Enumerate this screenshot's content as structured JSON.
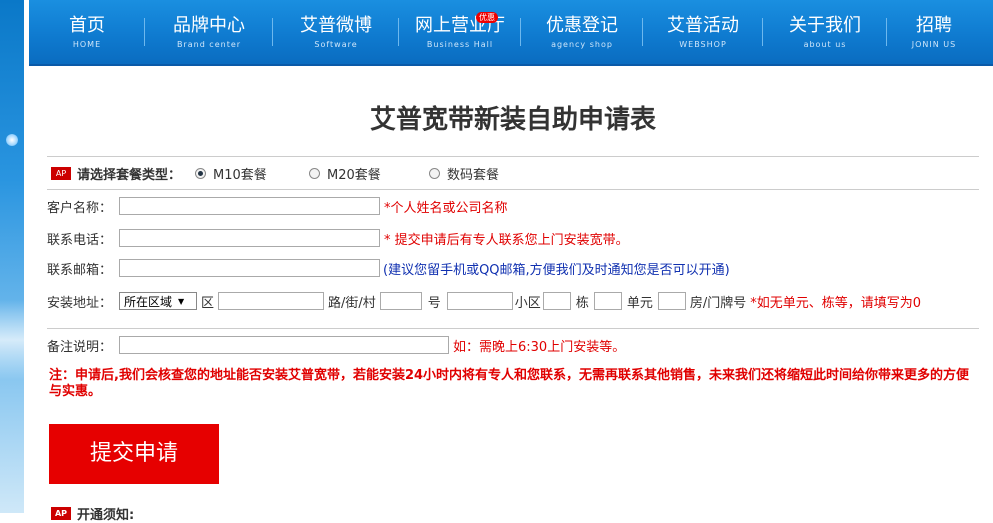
{
  "nav": {
    "items": [
      {
        "label": "首页",
        "sub": "HOME"
      },
      {
        "label": "品牌中心",
        "sub": "Brand center"
      },
      {
        "label": "艾普微博",
        "sub": "Software"
      },
      {
        "label": "网上营业厅",
        "sub": "Business Hall",
        "badge": "优惠"
      },
      {
        "label": "优惠登记",
        "sub": "agency  shop"
      },
      {
        "label": "艾普活动",
        "sub": "WEBSHOP"
      },
      {
        "label": "关于我们",
        "sub": "about us"
      },
      {
        "label": "招聘",
        "sub": "JONIN US"
      }
    ]
  },
  "form": {
    "title": "艾普宽带新装自助申请表",
    "package": {
      "icon": "AP",
      "label": "请选择套餐类型：",
      "options": [
        "M10套餐",
        "M20套餐",
        "数码套餐"
      ],
      "selected": "M10套餐"
    },
    "customer_name": {
      "label": "客户名称：",
      "value": "",
      "hint": "*个人姓名或公司名称"
    },
    "phone": {
      "label": "联系电话：",
      "value": "",
      "hint": "* 提交申请后有专人联系您上门安装宽带。"
    },
    "email": {
      "label": "联系邮箱：",
      "value": "",
      "hint": "(建议您留手机或QQ邮箱,方便我们及时通知您是否可以开通)"
    },
    "address": {
      "label": "安装地址：",
      "region_select": "所在区域",
      "district": "区",
      "road": "路/街/村",
      "number": "号",
      "community": "小区",
      "building": "栋",
      "unit": "单元",
      "room": "房/门牌号",
      "hint": "*如无单元、栋等，请填写为0"
    },
    "remark": {
      "label": "备注说明：",
      "value": "",
      "hint": "如：需晚上6:30上门安装等。"
    },
    "notice": "注：申请后,我们会核查您的地址能否安装艾普宽带，若能安装24小时内将有专人和您联系，无需再联系其他销售，未来我们还将缩短此时间给你带来更多的方便与实惠。",
    "submit": "提交申请",
    "footer_heading": "开通须知:"
  }
}
